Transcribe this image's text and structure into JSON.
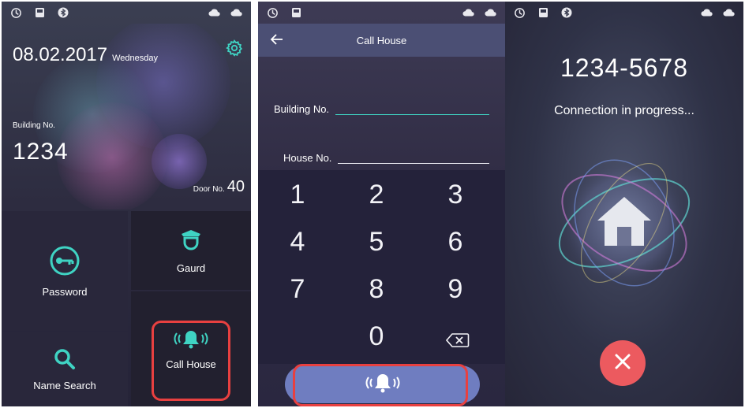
{
  "screen_home": {
    "date": "08.02.2017",
    "weekday": "Wednesday",
    "building_label": "Building No.",
    "building_number": "1234",
    "door_label": "Door No.",
    "door_number": "40",
    "tiles": {
      "password": "Password",
      "guard": "Gaurd",
      "name_search": "Name Search",
      "call_house": "Call House"
    }
  },
  "screen_dial": {
    "title": "Call House",
    "building_label": "Building No.",
    "building_value": "",
    "house_label": "House No.",
    "house_value": "",
    "keys": [
      "1",
      "2",
      "3",
      "4",
      "5",
      "6",
      "7",
      "8",
      "9",
      "0"
    ]
  },
  "screen_calling": {
    "number": "1234-5678",
    "status": "Connection in progress..."
  },
  "icons": {
    "status": [
      "sync-icon",
      "sd-card-icon",
      "bluetooth-icon",
      "cloud-icon",
      "ls-cloud-icon"
    ],
    "settings": "gear-icon",
    "back": "arrow-left-icon",
    "backspace": "backspace-icon",
    "bell": "bell-icon",
    "home": "house-icon",
    "hangup": "close-icon"
  },
  "colors": {
    "accent_teal": "#3fd3c3",
    "call_bar": "#6f7dc0",
    "highlight": "#e84040",
    "hangup": "#ec5a5f"
  }
}
